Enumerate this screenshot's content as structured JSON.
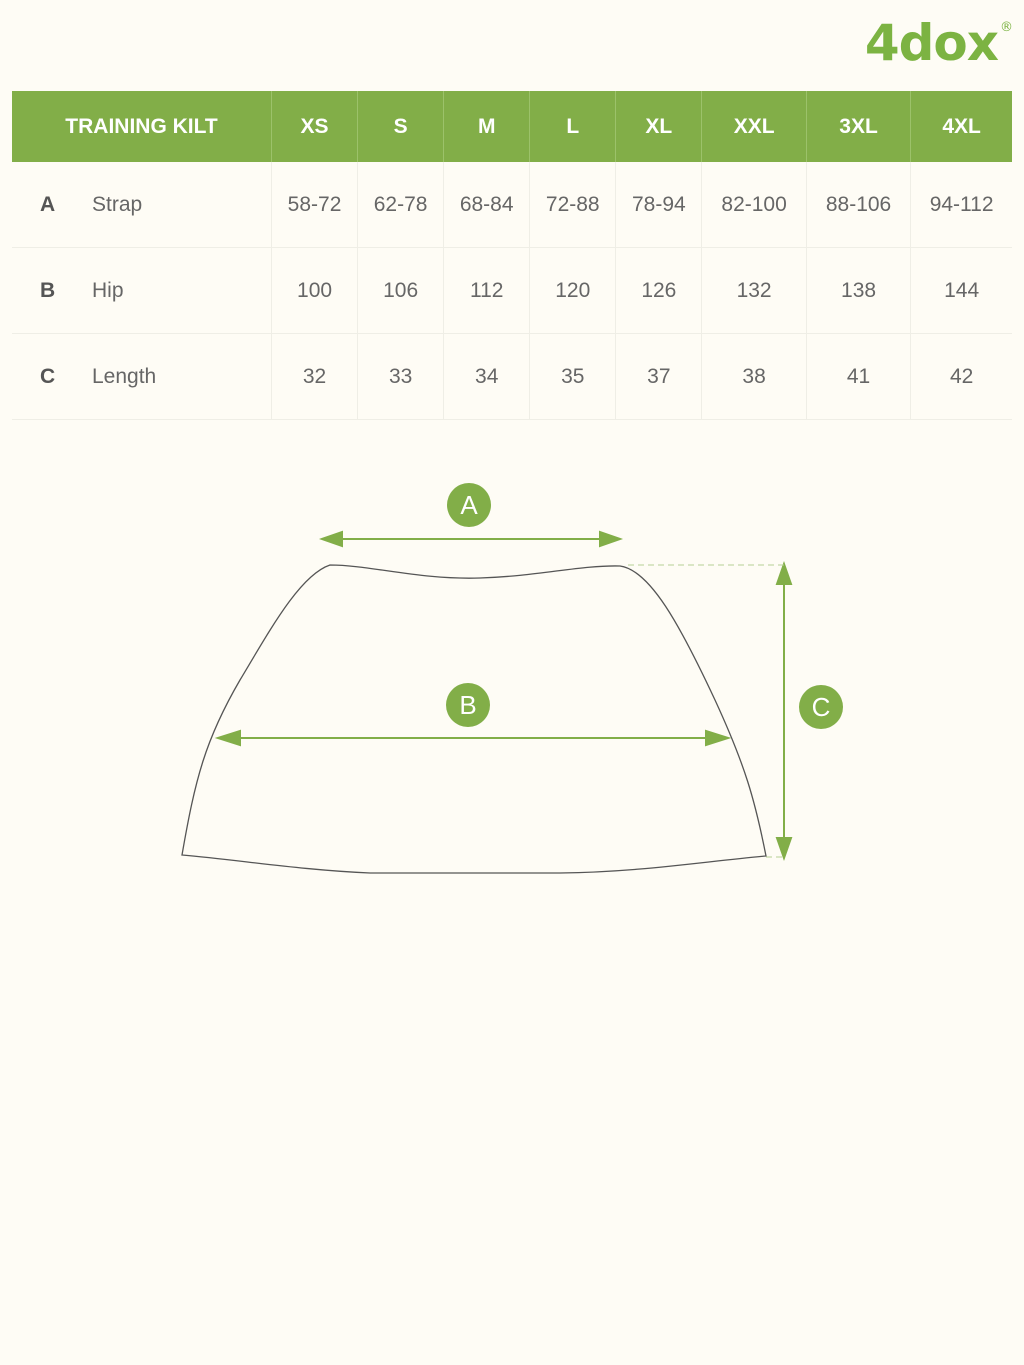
{
  "brand": {
    "logo_text": "4dox",
    "registered": "®",
    "accent": "#82ae48"
  },
  "table": {
    "title": "TRAINING KILT",
    "sizes": [
      "XS",
      "S",
      "M",
      "L",
      "XL",
      "XXL",
      "3XL",
      "4XL"
    ],
    "rows": [
      {
        "code": "A",
        "name": "Strap",
        "values": [
          "58-72",
          "62-78",
          "68-84",
          "72-88",
          "78-94",
          "82-100",
          "88-106",
          "94-112"
        ]
      },
      {
        "code": "B",
        "name": "Hip",
        "values": [
          "100",
          "106",
          "112",
          "120",
          "126",
          "132",
          "138",
          "144"
        ]
      },
      {
        "code": "C",
        "name": "Length",
        "values": [
          "32",
          "33",
          "34",
          "35",
          "37",
          "38",
          "41",
          "42"
        ]
      }
    ]
  },
  "diagram": {
    "labels": [
      "A",
      "B",
      "C"
    ]
  }
}
